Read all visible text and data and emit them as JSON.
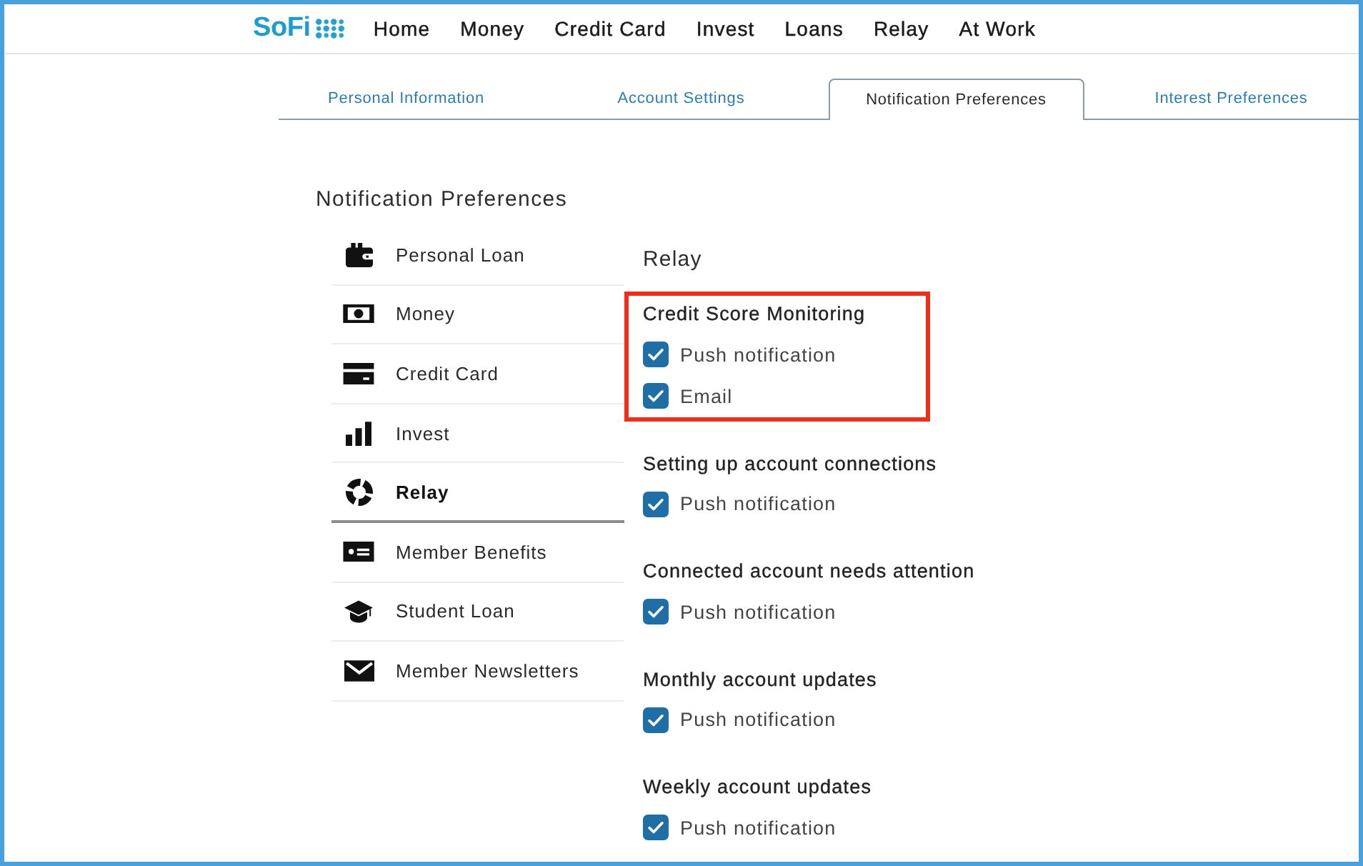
{
  "header": {
    "logo": "SoFi",
    "nav": [
      "Home",
      "Money",
      "Credit Card",
      "Invest",
      "Loans",
      "Relay",
      "At Work"
    ]
  },
  "tabs": [
    {
      "label": "Personal Information",
      "selected": false
    },
    {
      "label": "Account Settings",
      "selected": false
    },
    {
      "label": "Notification Preferences",
      "selected": true
    },
    {
      "label": "Interest Preferences",
      "selected": false
    }
  ],
  "section_title": "Notification Preferences",
  "sidebar": {
    "items": [
      {
        "label": "Personal Loan",
        "selected": false
      },
      {
        "label": "Money",
        "selected": false
      },
      {
        "label": "Credit Card",
        "selected": false
      },
      {
        "label": "Invest",
        "selected": false
      },
      {
        "label": "Relay",
        "selected": true
      },
      {
        "label": "Member Benefits",
        "selected": false
      },
      {
        "label": "Student Loan",
        "selected": false
      },
      {
        "label": "Member Newsletters",
        "selected": false
      }
    ]
  },
  "content": {
    "title": "Relay",
    "groups": [
      {
        "title": "Credit Score Monitoring",
        "highlighted": true,
        "options": [
          {
            "label": "Push notification",
            "checked": true
          },
          {
            "label": "Email",
            "checked": true
          }
        ]
      },
      {
        "title": "Setting up account connections",
        "highlighted": false,
        "options": [
          {
            "label": "Push notification",
            "checked": true
          }
        ]
      },
      {
        "title": "Connected account needs attention",
        "highlighted": false,
        "options": [
          {
            "label": "Push notification",
            "checked": true
          }
        ]
      },
      {
        "title": "Monthly account updates",
        "highlighted": false,
        "options": [
          {
            "label": "Push notification",
            "checked": true
          }
        ]
      },
      {
        "title": "Weekly account updates",
        "highlighted": false,
        "options": [
          {
            "label": "Push notification",
            "checked": true
          }
        ]
      }
    ]
  }
}
